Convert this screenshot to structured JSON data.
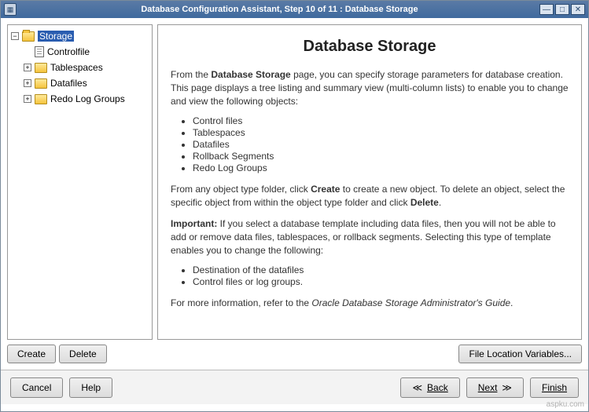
{
  "window": {
    "title": "Database Configuration Assistant, Step 10 of 11 : Database Storage"
  },
  "tree": {
    "root": "Storage",
    "items": [
      {
        "label": "Controlfile"
      },
      {
        "label": "Tablespaces"
      },
      {
        "label": "Datafiles"
      },
      {
        "label": "Redo Log Groups"
      }
    ],
    "buttons": {
      "create": "Create",
      "delete": "Delete"
    }
  },
  "main": {
    "heading": "Database Storage",
    "intro_prefix": "From the ",
    "intro_bold": "Database Storage",
    "intro_suffix": " page, you can specify storage parameters for database creation. This page displays a tree listing and summary view (multi-column lists) to enable you to change and view the following objects:",
    "list1": [
      "Control files",
      "Tablespaces",
      "Datafiles",
      "Rollback Segments",
      "Redo Log Groups"
    ],
    "para2_a": "From any object type folder, click ",
    "para2_create": "Create",
    "para2_b": " to create a new object. To delete an object, select the specific object from within the object type folder and click ",
    "para2_delete": "Delete",
    "para2_c": ".",
    "important_label": "Important:",
    "important_text": " If you select a database template including data files, then you will not be able to add or remove data files, tablespaces, or rollback segments. Selecting this type of template enables you to change the following:",
    "list2": [
      "Destination of the datafiles",
      "Control files or log groups."
    ],
    "more_a": "For more information, refer to the ",
    "more_i": "Oracle Database Storage Administrator's Guide",
    "more_b": ".",
    "file_loc_btn": "File Location Variables..."
  },
  "nav": {
    "cancel": "Cancel",
    "help": "Help",
    "back": "Back",
    "next": "Next",
    "finish": "Finish"
  },
  "watermark": "aspku.com"
}
